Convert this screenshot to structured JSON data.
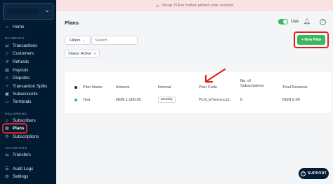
{
  "banner": {
    "icon": "warning-icon",
    "text": "Setup 2FA to further protect your account"
  },
  "sidebar": {
    "home": "Home",
    "payments_heading": "PAYMENTS",
    "transactions": "Transactions",
    "customers": "Customers",
    "refunds": "Refunds",
    "payouts": "Payouts",
    "disputes": "Disputes",
    "transaction_splits": "Transaction Splits",
    "subaccounts": "Subaccounts",
    "terminals": "Terminals",
    "recurring_heading": "RECURRING",
    "subscribers": "Subscribers",
    "plans": "Plans",
    "subscriptions": "Subscriptions",
    "transfers_heading": "TRANSFERS",
    "transfers": "Transfers",
    "audit_logs": "Audit Logs",
    "settings": "Settings"
  },
  "header": {
    "title": "Plans",
    "live_label": "Live",
    "help": "?"
  },
  "toolbar": {
    "filters_label": "Filters",
    "search_placeholder": "Search",
    "status_chip": "Status: Active",
    "new_plan_label": "+ New Plan"
  },
  "table": {
    "columns": [
      "Plan Name",
      "Amount",
      "Interval",
      "Plan Code",
      "No. of Subscriptions",
      "Total Revenue"
    ],
    "rows": [
      {
        "name": "Test",
        "amount": "NGN 1,000.00",
        "interval": "Monthly",
        "code": "PLN_b7wrnxccz2...",
        "subscriptions": "0",
        "revenue": "NGN 0.00"
      }
    ]
  },
  "support_label": "SUPPORT",
  "colors": {
    "sidebar": "#011b33",
    "accent_green": "#3bb75e",
    "highlight_red": "#e02020",
    "banner": "#f9e1e4"
  }
}
